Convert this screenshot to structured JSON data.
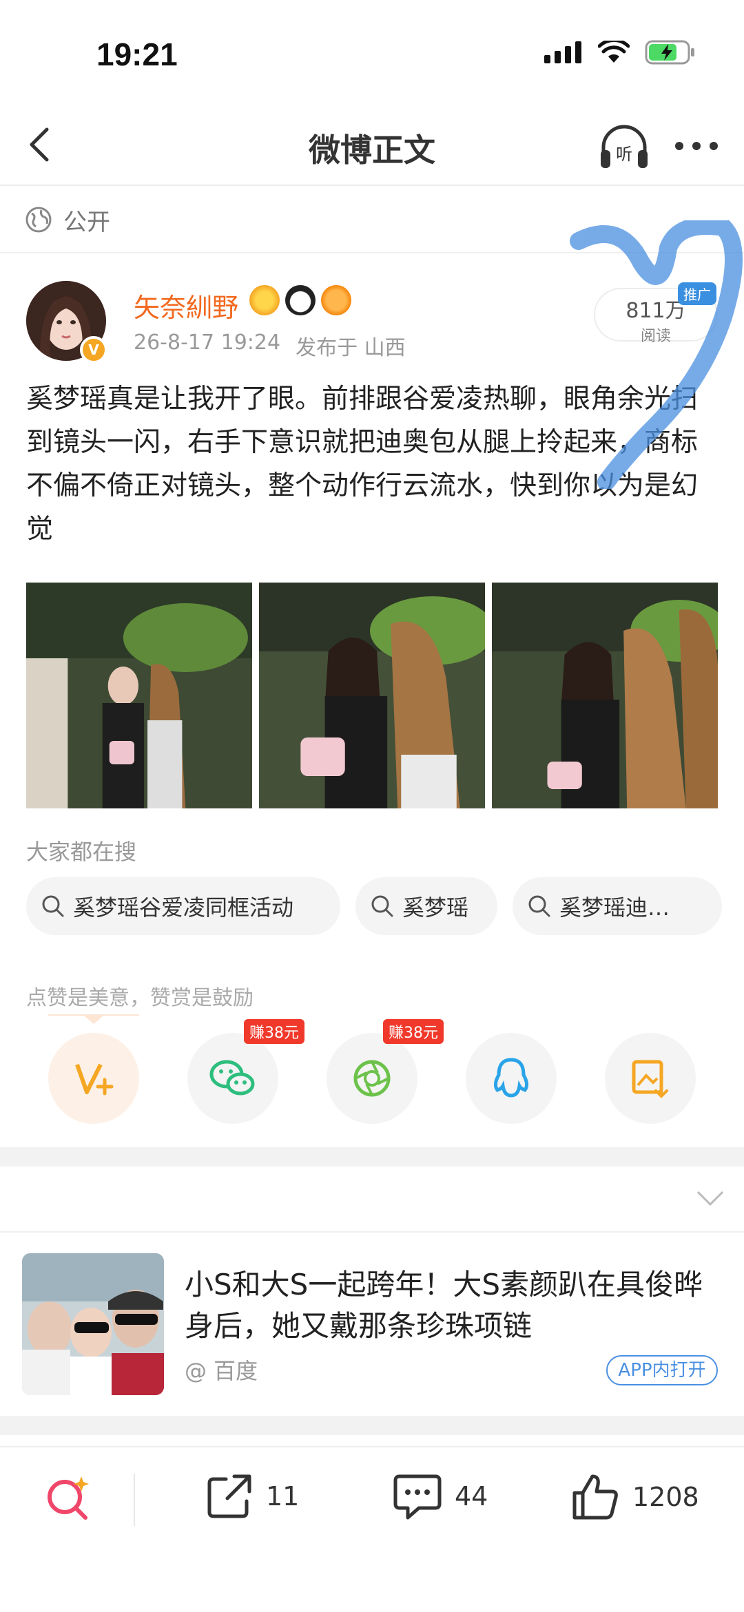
{
  "status_bar": {
    "time": "19:21"
  },
  "nav": {
    "title": "微博正文",
    "listen_label": "听"
  },
  "visibility": {
    "label": "公开"
  },
  "post": {
    "author": "矢奈紃野",
    "timestamp": "26-8-17 19:24",
    "location": "发布于 山西",
    "read_count": "811万",
    "read_label": "阅读",
    "promo_tag": "推广",
    "text": "奚梦瑶真是让我开了眼。前排跟谷爱凌热聊，眼角余光扫到镜头一闪，右手下意识就把迪奥包从腿上拎起来，商标不偏不倚正对镜头，整个动作行云流水，快到你以为是幻觉"
  },
  "search_section": {
    "title": "大家都在搜",
    "chips": [
      "奚梦瑶谷爱凌同框活动",
      "奚梦瑶",
      "奚梦瑶迪…"
    ]
  },
  "reward": {
    "title": "点赞是美意，赞赏是鼓励",
    "wechat_badge": "赚38元",
    "moments_badge": "赚38元"
  },
  "feed_card": {
    "title": "小S和大S一起跨年！大S素颜趴在具俊晔身后，她又戴那条珍珠项链",
    "source": "@ 百度",
    "open_label": "APP内打开"
  },
  "bottom_bar": {
    "repost_count": "11",
    "comment_count": "44",
    "like_count": "1208"
  },
  "colors": {
    "brand_orange": "#f2691e",
    "link_blue": "#4a90e2",
    "badge_red": "#f0392b"
  }
}
